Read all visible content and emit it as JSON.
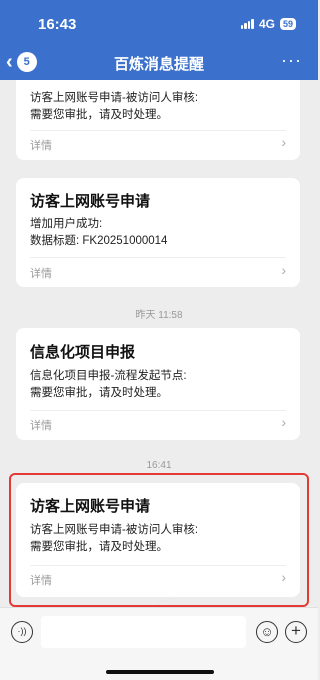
{
  "status": {
    "time": "16:43",
    "network": "4G",
    "battery": "59"
  },
  "nav": {
    "back_count": "5",
    "title": "百炼消息提醒",
    "more": "···"
  },
  "icons": {
    "back": "chevron-left-icon",
    "more": "more-dots-icon",
    "voice": "voice-icon",
    "emoji": "emoji-icon",
    "add": "plus-icon",
    "detail": "chevron-right-icon"
  },
  "colors": {
    "header": "#3b71cc",
    "highlight": "#e53935",
    "background": "#ededed"
  },
  "messages": [
    {
      "lines": [
        "访客上网账号申请-被访问人审核:",
        "需要您审批，请及时处理。"
      ],
      "detail": "详情",
      "chevron": "›"
    },
    {
      "title": "访客上网账号申请",
      "lines": [
        "增加用户成功:",
        "数据标题: FK20251000014"
      ],
      "detail": "详情",
      "chevron": "›"
    },
    {
      "title": "信息化项目申报",
      "lines": [
        "信息化项目申报-流程发起节点:",
        "需要您审批，请及时处理。"
      ],
      "detail": "详情",
      "chevron": "›"
    },
    {
      "title": "访客上网账号申请",
      "lines": [
        "访客上网账号申请-被访问人审核:",
        "需要您审批，请及时处理。"
      ],
      "detail": "详情",
      "chevron": "›"
    }
  ],
  "timestamps": [
    "昨天 11:58",
    "16:41"
  ],
  "input": {
    "placeholder": "",
    "value": "",
    "voice_glyph": "·))",
    "emoji_glyph": "☺",
    "plus_glyph": "+"
  }
}
